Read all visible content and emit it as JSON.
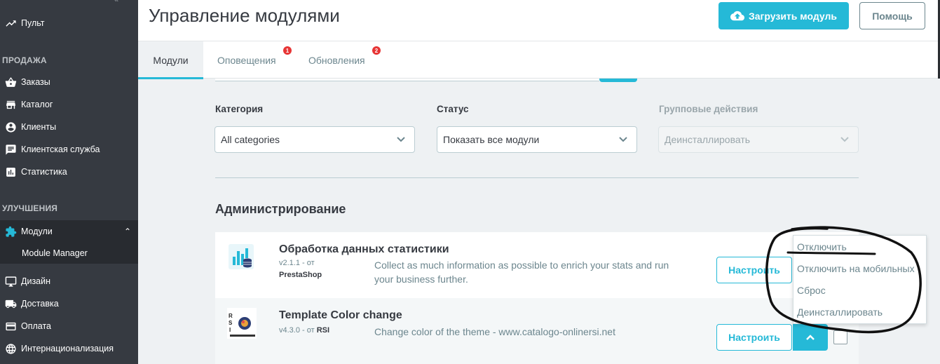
{
  "sidebar": {
    "items": [
      {
        "label": "Пульт",
        "icon": "trending-icon"
      },
      {
        "label": "Заказы",
        "icon": "basket-icon"
      },
      {
        "label": "Каталог",
        "icon": "store-icon"
      },
      {
        "label": "Клиенты",
        "icon": "account-icon"
      },
      {
        "label": "Клиентская служба",
        "icon": "chat-icon"
      },
      {
        "label": "Статистика",
        "icon": "chart-icon"
      },
      {
        "label": "Модули",
        "icon": "puzzle-icon"
      },
      {
        "label": "Module Manager"
      },
      {
        "label": "Дизайн",
        "icon": "monitor-icon"
      },
      {
        "label": "Доставка",
        "icon": "truck-icon"
      },
      {
        "label": "Оплата",
        "icon": "card-icon"
      },
      {
        "label": "Интернационализация",
        "icon": "globe-icon"
      }
    ],
    "sections": [
      "ПРОДАЖА",
      "УЛУЧШЕНИЯ"
    ]
  },
  "header": {
    "title": "Управление модулями",
    "upload_label": "Загрузить модуль",
    "help_label": "Помощь"
  },
  "tabs": [
    {
      "label": "Модули",
      "badge": ""
    },
    {
      "label": "Оповещения",
      "badge": "1"
    },
    {
      "label": "Обновления",
      "badge": "2"
    }
  ],
  "filters": {
    "category": {
      "label": "Категория",
      "value": "All categories"
    },
    "status": {
      "label": "Статус",
      "value": "Показать все модули"
    },
    "bulk": {
      "label": "Групповые действия",
      "value": "Деинсталлировать"
    }
  },
  "section_title": "Администрирование",
  "modules": [
    {
      "name": "Обработка данных статистики",
      "version": "v2.1.1 - от",
      "author": "PrestaShop",
      "description": "Collect as much information as possible to enrich your stats and run your business further.",
      "config_label": "Настроить"
    },
    {
      "name": "Template Color change",
      "version": "v4.3.0 - от",
      "author": "RSI",
      "description": "Change color of the theme - www.catalogo-onlinersi.net",
      "config_label": "Настроить"
    }
  ],
  "dropdown": {
    "items": [
      "Отключить",
      "Отключить на мобильных",
      "Сброс",
      "Деинсталлировать"
    ]
  },
  "colors": {
    "accent": "#25b9d7",
    "sidebar": "#363a41",
    "badge": "#e73535"
  }
}
